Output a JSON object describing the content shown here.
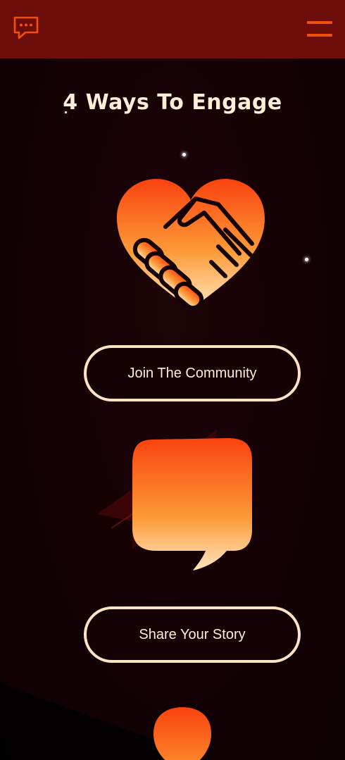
{
  "header": {
    "logo_icon": "chat-bubble-dots-icon",
    "menu_icon": "hamburger-menu-icon",
    "background": "#6e0e0b",
    "accent": "#f24f0c"
  },
  "main": {
    "title": "4 Ways To Engage",
    "cards": [
      {
        "icon": "heart-handshake-icon",
        "button_label": "Join The Community"
      },
      {
        "icon": "speech-bubble-icon",
        "button_label": "Share Your Story"
      },
      {
        "icon": "drop-icon",
        "button_label": ""
      }
    ]
  },
  "colors": {
    "page_bg": "#130104",
    "gradient_top": "#f9420e",
    "gradient_bottom": "#ffe2b5",
    "button_border": "#fbe3c4",
    "text": "#fdeed8"
  }
}
